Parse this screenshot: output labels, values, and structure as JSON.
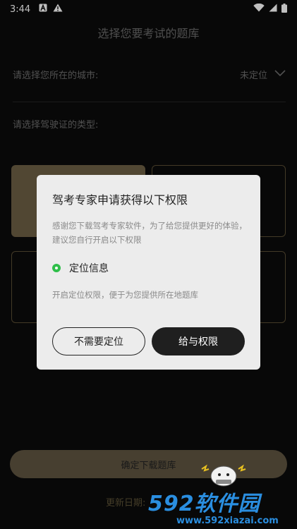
{
  "status_bar": {
    "time": "3:44",
    "icons": [
      "notification-a-icon",
      "warning-icon",
      "wifi-icon",
      "signal-icon",
      "battery-icon"
    ]
  },
  "page": {
    "title": "选择您要考试的题库",
    "city_label": "请选择您所在的城市:",
    "city_value": "未定位",
    "type_label": "请选择驾驶证的类型:",
    "confirm_button": "确定下载题库",
    "update_date": "更新日期: "
  },
  "dialog": {
    "title": "驾考专家申请获得以下权限",
    "description": "感谢您下载驾考专家软件，为了给您提供更好的体验，建议您自行开启以下权限",
    "permission_name": "定位信息",
    "permission_desc": "开启定位权限，便于为您提供所在地题库",
    "deny_button": "不需要定位",
    "grant_button": "给与权限"
  },
  "watermark": {
    "main": "592软件园",
    "url": "www.592xiazai.com"
  },
  "colors": {
    "background": "#0b0b0b",
    "accent_gold": "#6c5f45",
    "dialog_bg": "#ececec",
    "permission_green": "#2fbf4a",
    "watermark_blue": "#2a8ee0"
  }
}
